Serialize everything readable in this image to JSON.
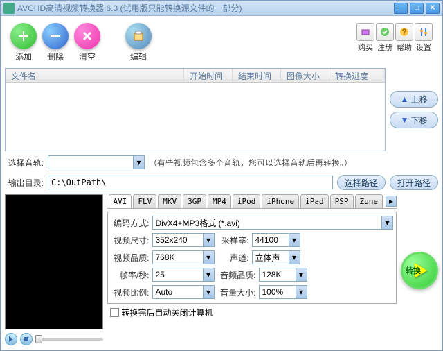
{
  "title": "AVCHD高清视频转换器 6.3 (试用版只能转换源文件的一部分)",
  "toolbar": {
    "add": "添加",
    "del": "删除",
    "clear": "清空",
    "edit": "编辑"
  },
  "smallbar": {
    "buy": "购买",
    "reg": "注册",
    "help": "帮助",
    "set": "设置"
  },
  "cols": {
    "name": "文件名",
    "start": "开始时间",
    "end": "结束时间",
    "size": "图像大小",
    "prog": "转换进度"
  },
  "side": {
    "up": "上移",
    "down": "下移"
  },
  "track": {
    "label": "选择音轨:",
    "hint": "（有些视频包含多个音轨，您可以选择音轨后再转换。）"
  },
  "output": {
    "label": "输出目录:",
    "path": "C:\\OutPath\\",
    "choose": "选择路径",
    "open": "打开路径"
  },
  "tabs": [
    "AVI",
    "FLV",
    "MKV",
    "3GP",
    "MP4",
    "iPod",
    "iPhone",
    "iPad",
    "PSP",
    "Zune"
  ],
  "settings": {
    "encode": {
      "label": "编码方式:",
      "value": "DivX4+MP3格式 (*.avi)"
    },
    "size": {
      "label": "视频尺寸:",
      "value": "352x240"
    },
    "rate": {
      "label": "采样率:",
      "value": "44100"
    },
    "vq": {
      "label": "视频品质:",
      "value": "768K"
    },
    "ch": {
      "label": "声道:",
      "value": "立体声"
    },
    "fps": {
      "label": "帧率/秒:",
      "value": "25"
    },
    "aq": {
      "label": "音频品质:",
      "value": "128K"
    },
    "aspect": {
      "label": "视频比例:",
      "value": "Auto"
    },
    "vol": {
      "label": "音量大小:",
      "value": "100%"
    }
  },
  "shutdown": "转换完后自动关闭计算机",
  "convert": "转换"
}
